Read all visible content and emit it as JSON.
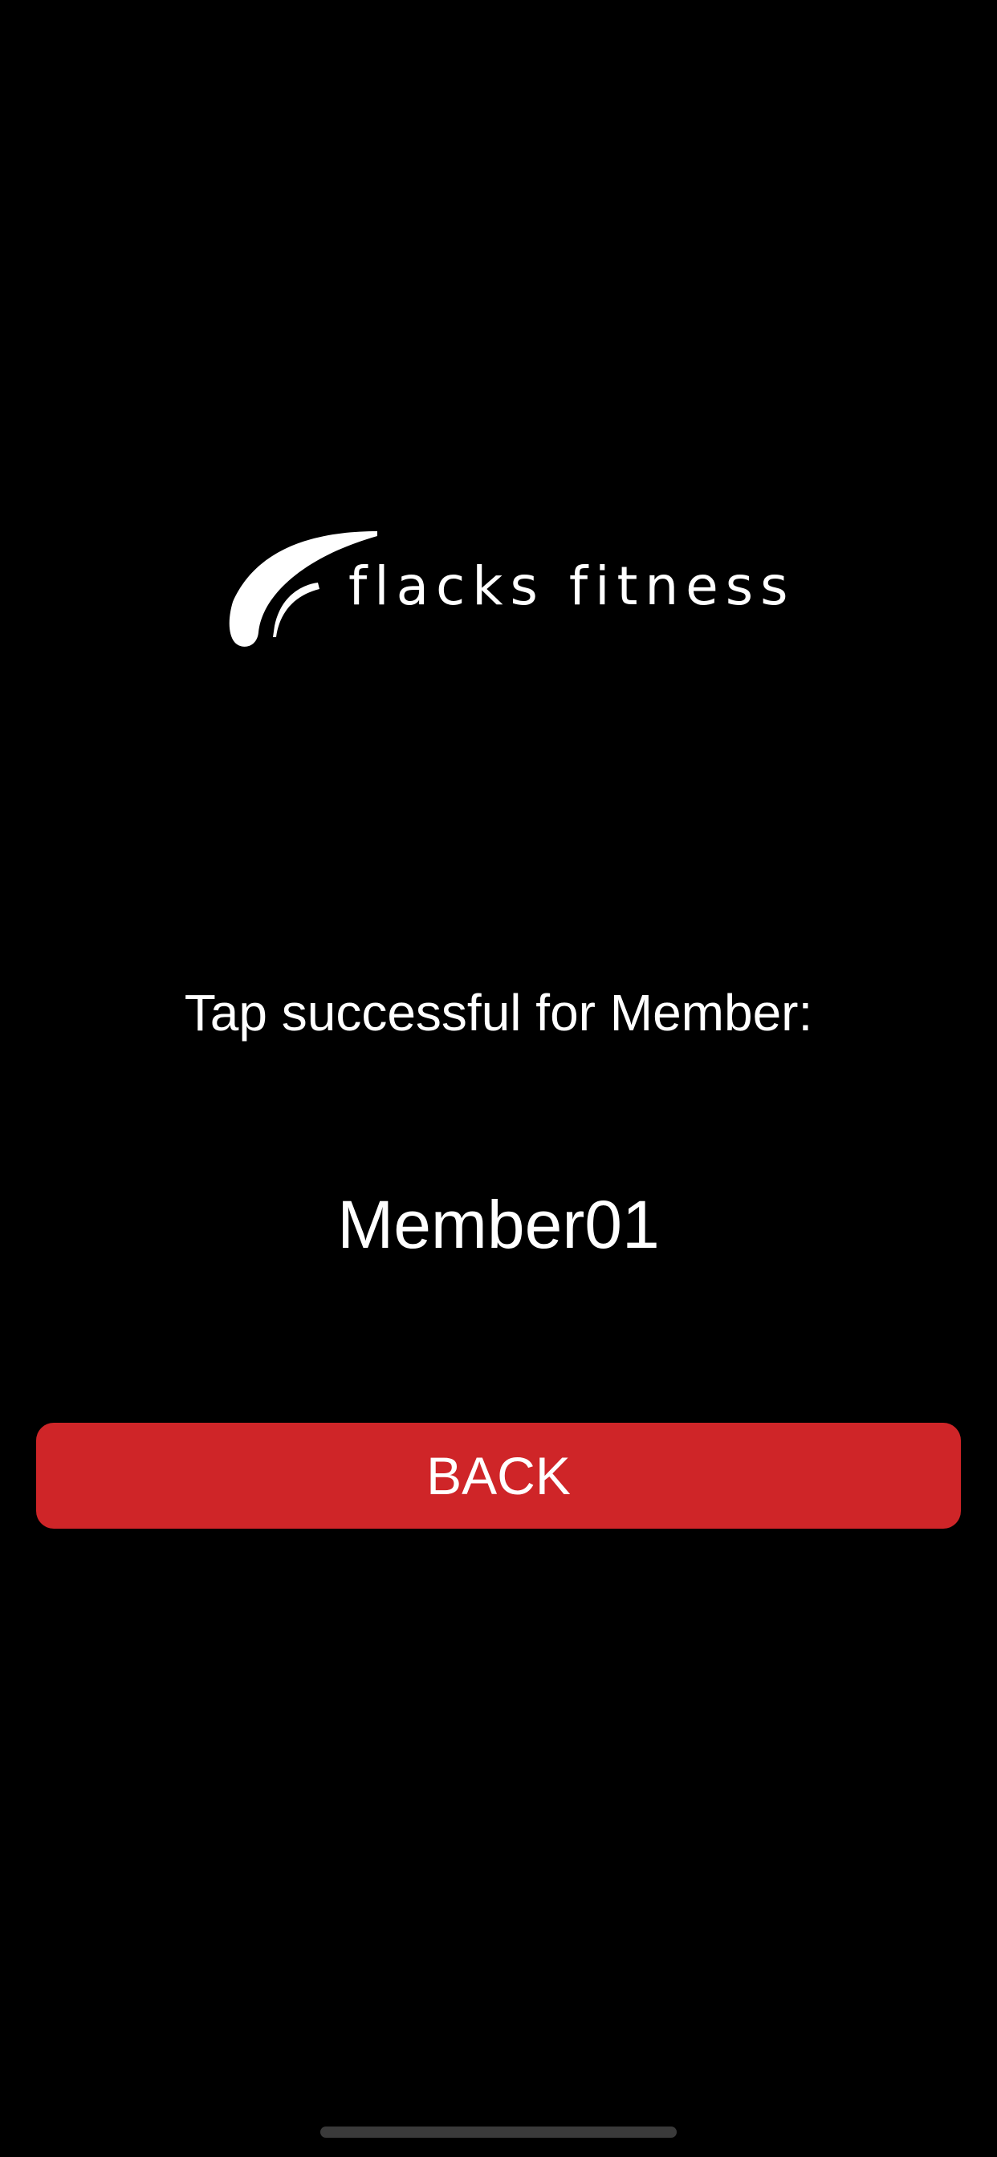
{
  "logo": {
    "mark_icon": "swoosh-f-logo-icon",
    "text": "flacks fitness"
  },
  "message": {
    "tap_text": "Tap successful for Member:",
    "member_name": "Member01"
  },
  "actions": {
    "back_label": "BACK"
  },
  "colors": {
    "background": "#000000",
    "button": "#cf2528",
    "text": "#ffffff"
  }
}
